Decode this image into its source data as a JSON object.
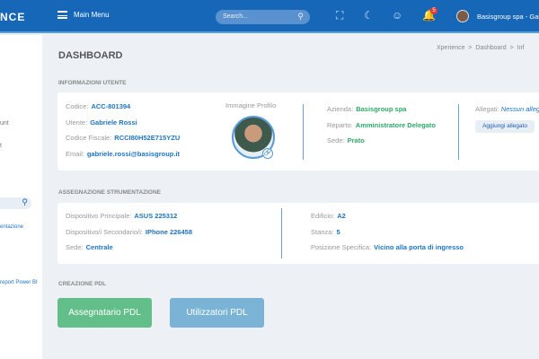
{
  "header": {
    "logo": "NCE",
    "menu_label": "Main Menu",
    "search_placeholder": "Search...",
    "notifications_count": "5",
    "user": "Basisgroup spa - Gab"
  },
  "sidebar": {
    "items": [
      "unt",
      "t",
      "entazione",
      "report Power BI"
    ]
  },
  "page": {
    "title": "DASHBOARD",
    "breadcrumb": [
      "Xperience",
      ">",
      "Dashboard",
      ">",
      "Inf"
    ]
  },
  "user_info": {
    "section": "INFORMAZIONI UTENTE",
    "fields": [
      {
        "label": "Codice:",
        "value": "ACC-801394"
      },
      {
        "label": "Utente:",
        "value": "Gabriele Rossi"
      },
      {
        "label": "Codice Fiscale:",
        "value": "RCCI80H52E715YZU"
      },
      {
        "label": "Email:",
        "value": "gabriele.rossi@basisgroup.it"
      }
    ],
    "photo_label": "Immagine Profilo",
    "company": [
      {
        "label": "Azienda:",
        "value": "Basisgroup spa"
      },
      {
        "label": "Reparto:",
        "value": "Amministratore Delegato"
      },
      {
        "label": "Sede:",
        "value": "Prato"
      }
    ],
    "attachments_label": "Allegati:",
    "attachments_value": "Nessun allegato",
    "add_attachment": "Aggiungi allegato"
  },
  "equipment": {
    "section": "ASSEGNAZIONE STRUMENTAZIONE",
    "left": [
      {
        "label": "Dispositivo Principale:",
        "value": "ASUS 225312"
      },
      {
        "label": "Dispositivo/i Secondario/i:",
        "value": "IPhone 226458"
      },
      {
        "label": "Sede:",
        "value": "Centrale"
      }
    ],
    "right": [
      {
        "label": "Edificio:",
        "value": "A2"
      },
      {
        "label": "Stanza:",
        "value": "5"
      },
      {
        "label": "Posizione Specifica:",
        "value": "Vicino alla porta di ingresso"
      }
    ]
  },
  "pdl": {
    "section": "CREAZIONE PDL",
    "assegnatario": "Assegnatario PDL",
    "utilizzatori": "Utilizzatori PDL"
  }
}
